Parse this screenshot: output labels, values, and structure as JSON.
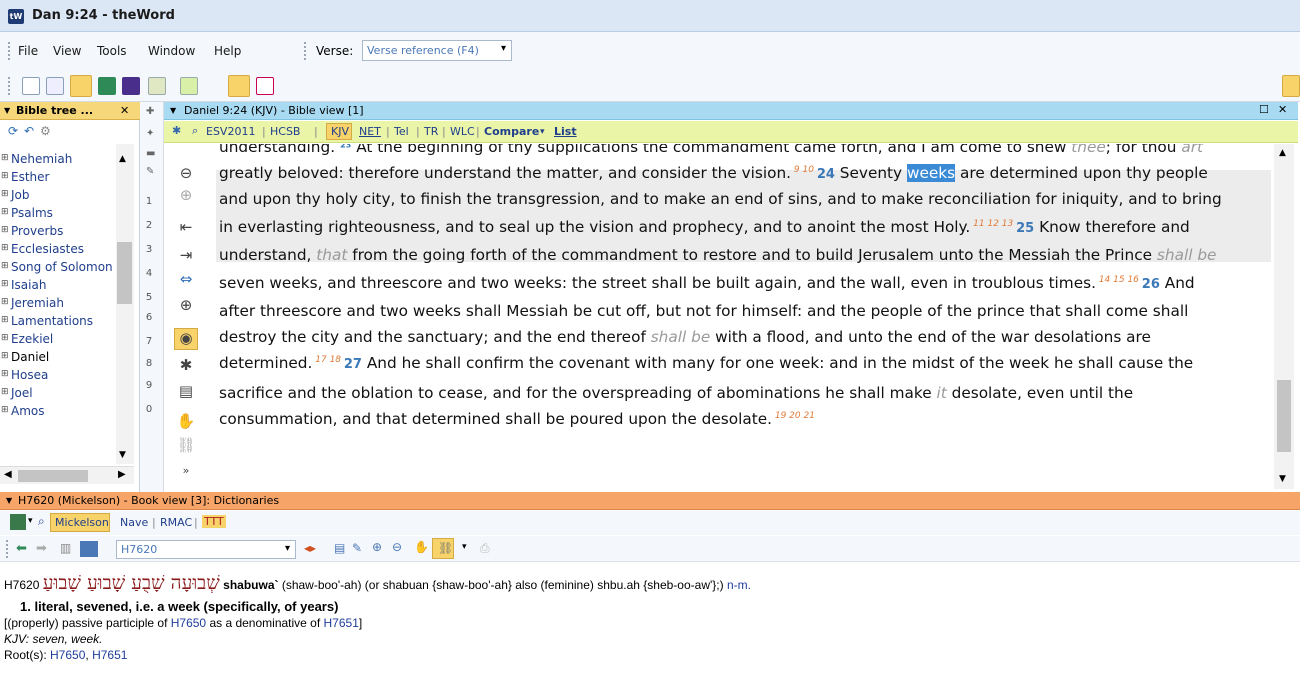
{
  "window": {
    "title": "Dan 9:24 - theWord",
    "app_icon": "tW"
  },
  "menu": {
    "items": [
      "File",
      "View",
      "Tools",
      "Window",
      "Help"
    ],
    "verse_label": "Verse:",
    "verse_placeholder": "Verse reference (F4)"
  },
  "bible_tree": {
    "title": "Bible tree ...",
    "books": [
      "Nehemiah",
      "Esther",
      "Job",
      "Psalms",
      "Proverbs",
      "Ecclesiastes",
      "Song of Solomon",
      "Isaiah",
      "Jeremiah",
      "Lamentations",
      "Ezekiel",
      "Daniel",
      "Hosea",
      "Joel",
      "Amos"
    ],
    "side_numbers": [
      "1",
      "2",
      "3",
      "4",
      "5",
      "6",
      "7",
      "8",
      "9",
      "0"
    ]
  },
  "bible_view": {
    "title": "Daniel 9:24 (KJV)  - Bible view [1]",
    "versions": [
      "ESV2011",
      "HCSB",
      "KJV",
      "NET",
      "Tel",
      "TR",
      "WLC"
    ],
    "compare_label": "Compare",
    "list_label": "List",
    "lines": [
      {
        "segs": [
          {
            "t": "understanding. ",
            "c": ""
          },
          {
            "t": "²³",
            "c": "vn"
          },
          {
            "t": " At the beginning of thy supplications the commandment came forth, and I am come to shew ",
            "c": ""
          },
          {
            "t": "thee",
            "c": "it"
          },
          {
            "t": "; for thou ",
            "c": ""
          },
          {
            "t": "art",
            "c": "it"
          }
        ]
      },
      {
        "segs": [
          {
            "t": "greatly beloved: therefore understand the matter, and consider the vision.",
            "c": ""
          },
          {
            "t": " 9 10 ",
            "c": "fn"
          },
          {
            "t": " 24",
            "c": "vn"
          },
          {
            "t": " Seventy ",
            "c": ""
          },
          {
            "t": "weeks",
            "c": "hl"
          },
          {
            "t": " are determined upon thy people",
            "c": ""
          }
        ]
      },
      {
        "segs": [
          {
            "t": "and upon thy holy city, to finish the transgression, and to make an end of sins, and to make reconciliation for iniquity, and to bring",
            "c": ""
          }
        ]
      },
      {
        "segs": [
          {
            "t": "in everlasting righteousness, and to seal up the vision and prophecy, and to anoint the most Holy.",
            "c": ""
          },
          {
            "t": " 11 12 13 ",
            "c": "fn"
          },
          {
            "t": " 25",
            "c": "vn"
          },
          {
            "t": " Know therefore and",
            "c": ""
          }
        ]
      },
      {
        "segs": [
          {
            "t": "understand, ",
            "c": ""
          },
          {
            "t": "that",
            "c": "it"
          },
          {
            "t": " from the going forth of the commandment to restore and to build Jerusalem unto the Messiah the Prince ",
            "c": ""
          },
          {
            "t": "shall be",
            "c": "it"
          }
        ]
      },
      {
        "segs": [
          {
            "t": "seven weeks, and threescore and two weeks: the street shall be built again, and the wall, even in troublous times.",
            "c": ""
          },
          {
            "t": " 14 15 16 ",
            "c": "fn"
          },
          {
            "t": " 26",
            "c": "vn"
          },
          {
            "t": " And",
            "c": ""
          }
        ]
      },
      {
        "segs": [
          {
            "t": "after threescore and two weeks shall Messiah be cut off, but not for himself: and the people of the prince that shall come shall",
            "c": ""
          }
        ]
      },
      {
        "segs": [
          {
            "t": "destroy the city and the sanctuary; and the end thereof ",
            "c": ""
          },
          {
            "t": "shall be",
            "c": "it"
          },
          {
            "t": " with a flood, and unto the end of the war desolations are",
            "c": ""
          }
        ]
      },
      {
        "segs": [
          {
            "t": "determined.",
            "c": ""
          },
          {
            "t": " 17 18 ",
            "c": "fn"
          },
          {
            "t": " 27",
            "c": "vn"
          },
          {
            "t": " And he shall confirm the covenant with many for one week: and in the midst of the week he shall cause the",
            "c": ""
          }
        ]
      },
      {
        "segs": [
          {
            "t": "sacrifice and the oblation to cease, and for the overspreading of abominations he shall make ",
            "c": ""
          },
          {
            "t": "it",
            "c": "it"
          },
          {
            "t": " desolate, even until the",
            "c": ""
          }
        ]
      },
      {
        "segs": [
          {
            "t": "consummation, and that determined shall be poured upon the desolate.",
            "c": ""
          },
          {
            "t": " 19 20 21",
            "c": "fn"
          }
        ]
      }
    ]
  },
  "dictionary": {
    "title": "H7620 (Mickelson) - Book view [3]: Dictionaries",
    "tabs": [
      "Mickelson",
      "Nave",
      "RMAC",
      "TTT"
    ],
    "strong_value": "H7620",
    "entry": {
      "num": "H7620",
      "hebrew": "שְׁבוּעָה שָׁבֻעַ שָׁבוּעַ שָׁבוּעַ",
      "word": "shabuwa`",
      "pron": " (shaw-boo'-ah) (or shabuan {shaw-boo'-ah} also (feminine) shbu.ah {sheb-oo-aw'};) ",
      "pos": "n-m.",
      "def": "1. literal, sevened, i.e. a week (specifically, of years)",
      "line3a": "[(properly) passive participle of ",
      "ref1": "H7650",
      "line3b": " as a denominative of ",
      "ref2": "H7651",
      "line3c": "]",
      "kjv": "KJV: seven, week.",
      "root_label": "Root(s): ",
      "root1": "H7650",
      "root_sep": ", ",
      "root2": "H7651"
    }
  }
}
